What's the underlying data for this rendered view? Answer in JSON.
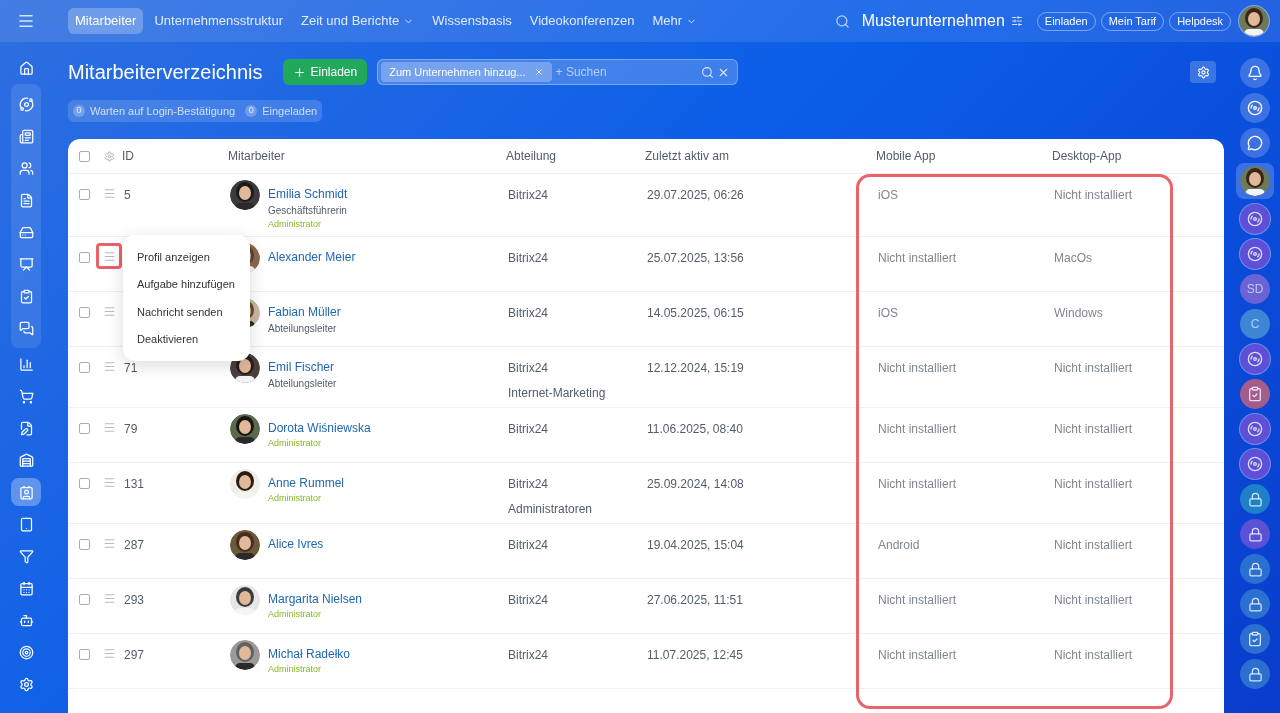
{
  "top_nav": {
    "tabs": [
      {
        "label": "Mitarbeiter",
        "selected": true,
        "has_menu": false
      },
      {
        "label": "Unternehmensstruktur",
        "selected": false,
        "has_menu": false
      },
      {
        "label": "Zeit und Berichte",
        "selected": false,
        "has_menu": true
      },
      {
        "label": "Wissensbasis",
        "selected": false,
        "has_menu": false
      },
      {
        "label": "Videokonferenzen",
        "selected": false,
        "has_menu": false
      },
      {
        "label": "Mehr",
        "selected": false,
        "has_menu": true
      }
    ],
    "company": "Musterunternehmen",
    "buttons": [
      "Einladen",
      "Mein Tarif",
      "Helpdesk"
    ]
  },
  "left_rail": [
    {
      "selected": false,
      "grouped": false
    },
    {
      "selected": false,
      "grouped": true
    },
    {
      "selected": false,
      "grouped": true
    },
    {
      "selected": false,
      "grouped": true
    },
    {
      "selected": false,
      "grouped": true
    },
    {
      "selected": false,
      "grouped": true
    },
    {
      "selected": false,
      "grouped": true
    },
    {
      "selected": false,
      "grouped": true
    },
    {
      "selected": false,
      "grouped": true
    },
    {
      "selected": false,
      "grouped": false
    },
    {
      "selected": false,
      "grouped": false
    },
    {
      "selected": false,
      "grouped": false
    },
    {
      "selected": false,
      "grouped": false
    },
    {
      "selected": true,
      "grouped": false
    },
    {
      "selected": false,
      "grouped": false
    },
    {
      "selected": false,
      "grouped": false
    },
    {
      "selected": false,
      "grouped": false
    },
    {
      "selected": false,
      "grouped": false
    },
    {
      "selected": false,
      "grouped": false
    },
    {
      "selected": false,
      "grouped": false
    }
  ],
  "page": {
    "title": "Mitarbeiterverzeichnis",
    "invite_button": "Einladen",
    "filter_chip": "Zum Unternehmen hinzug...",
    "search_placeholder": "+ Suchen",
    "counters": [
      {
        "count": "0",
        "label": "Warten auf Login-Bestätigung"
      },
      {
        "count": "0",
        "label": "Eingeladen"
      }
    ]
  },
  "table": {
    "all_checked": false,
    "columns": [
      {
        "label": "ID",
        "highlighted": false
      },
      {
        "label": "Mitarbeiter",
        "highlighted": false
      },
      {
        "label": "Abteilung",
        "highlighted": false
      },
      {
        "label": "Zuletzt aktiv am",
        "highlighted": false
      },
      {
        "label": "Mobile App",
        "highlighted": true
      },
      {
        "label": "Desktop-App",
        "highlighted": true
      }
    ],
    "rows": [
      {
        "checked": false,
        "id": "5",
        "name": "Emilia Schmidt",
        "subtitles": [
          {
            "text": "Geschäftsführerin",
            "kind": "position"
          },
          {
            "text": "Administrator",
            "kind": "role"
          }
        ],
        "departments": [
          "Bitrix24"
        ],
        "last_active": "29.07.2025, 06:26",
        "mobile": "iOS",
        "desktop": "Nicht installiert",
        "menu_highlighted": false
      },
      {
        "checked": false,
        "name": "Alexander Meier",
        "subtitles": [],
        "departments": [
          "Bitrix24"
        ],
        "last_active": "25.07.2025, 13:56",
        "mobile": "Nicht installiert",
        "desktop": "MacOs",
        "menu_highlighted": true,
        "context_menu": [
          "Profil anzeigen",
          "Aufgabe hinzufügen",
          "Nachricht senden",
          "Deaktivieren"
        ]
      },
      {
        "checked": false,
        "name": "Fabian Müller",
        "subtitles": [
          {
            "text": "Abteilungsleiter",
            "kind": "position"
          }
        ],
        "departments": [
          "Bitrix24"
        ],
        "last_active": "14.05.2025, 06:15",
        "mobile": "iOS",
        "desktop": "Windows",
        "menu_highlighted": false
      },
      {
        "checked": false,
        "id": "71",
        "name": "Emil Fischer",
        "subtitles": [
          {
            "text": "Abteilungsleiter",
            "kind": "position"
          }
        ],
        "departments": [
          "Bitrix24",
          "Internet-Marketing"
        ],
        "last_active": "12.12.2024, 15:19",
        "mobile": "Nicht installiert",
        "desktop": "Nicht installiert",
        "menu_highlighted": false
      },
      {
        "checked": false,
        "id": "79",
        "name": "Dorota Wiśniewska",
        "subtitles": [
          {
            "text": "Administrator",
            "kind": "role"
          }
        ],
        "departments": [
          "Bitrix24"
        ],
        "last_active": "11.06.2025, 08:40",
        "mobile": "Nicht installiert",
        "desktop": "Nicht installiert",
        "menu_highlighted": false
      },
      {
        "checked": false,
        "id": "131",
        "name": "Anne Rummel",
        "subtitles": [
          {
            "text": "Administrator",
            "kind": "role"
          }
        ],
        "departments": [
          "Bitrix24",
          "Administratoren"
        ],
        "last_active": "25.09.2024, 14:08",
        "mobile": "Nicht installiert",
        "desktop": "Nicht installiert",
        "menu_highlighted": false
      },
      {
        "checked": false,
        "id": "287",
        "name": "Alice Ivres",
        "subtitles": [],
        "departments": [
          "Bitrix24"
        ],
        "last_active": "19.04.2025, 15:04",
        "mobile": "Android",
        "desktop": "Nicht installiert",
        "menu_highlighted": false
      },
      {
        "checked": false,
        "id": "293",
        "name": "Margarita Nielsen",
        "subtitles": [
          {
            "text": "Administrator",
            "kind": "role"
          }
        ],
        "departments": [
          "Bitrix24"
        ],
        "last_active": "27.06.2025, 11:51",
        "mobile": "Nicht installiert",
        "desktop": "Nicht installiert",
        "menu_highlighted": false
      },
      {
        "checked": false,
        "id": "297",
        "name": "Michał Radełko",
        "subtitles": [
          {
            "text": "Administrator",
            "kind": "role"
          }
        ],
        "departments": [
          "Bitrix24"
        ],
        "last_active": "11.07.2025, 12:45",
        "mobile": "Nicht installiert",
        "desktop": "Nicht installiert",
        "menu_highlighted": false
      }
    ]
  },
  "right_rail": [
    {
      "kind": "bell"
    },
    {
      "kind": "app"
    },
    {
      "kind": "chat"
    },
    {
      "kind": "avatar"
    },
    {
      "kind": "app",
      "color": "#5d4fd8"
    },
    {
      "kind": "app",
      "color": "#5d4fd8"
    },
    {
      "kind": "initials",
      "text": "SD",
      "color": "#6a63d6"
    },
    {
      "kind": "initials",
      "text": "C",
      "color": "#3d86d4"
    },
    {
      "kind": "app",
      "color": "#5d4fd8"
    },
    {
      "kind": "task",
      "color": "#a35d8c"
    },
    {
      "kind": "app",
      "color": "#5d4fd8"
    },
    {
      "kind": "app",
      "color": "#5d4fd8"
    },
    {
      "kind": "lock",
      "color": "#1d80c8"
    },
    {
      "kind": "lock",
      "color": "#5a52d4"
    },
    {
      "kind": "lock",
      "color": "#2b6fd0"
    },
    {
      "kind": "lock",
      "color": "#2b6fd0"
    },
    {
      "kind": "task",
      "color": "#2b6fd0"
    },
    {
      "kind": "lock",
      "color": "#2b6fd0"
    }
  ]
}
